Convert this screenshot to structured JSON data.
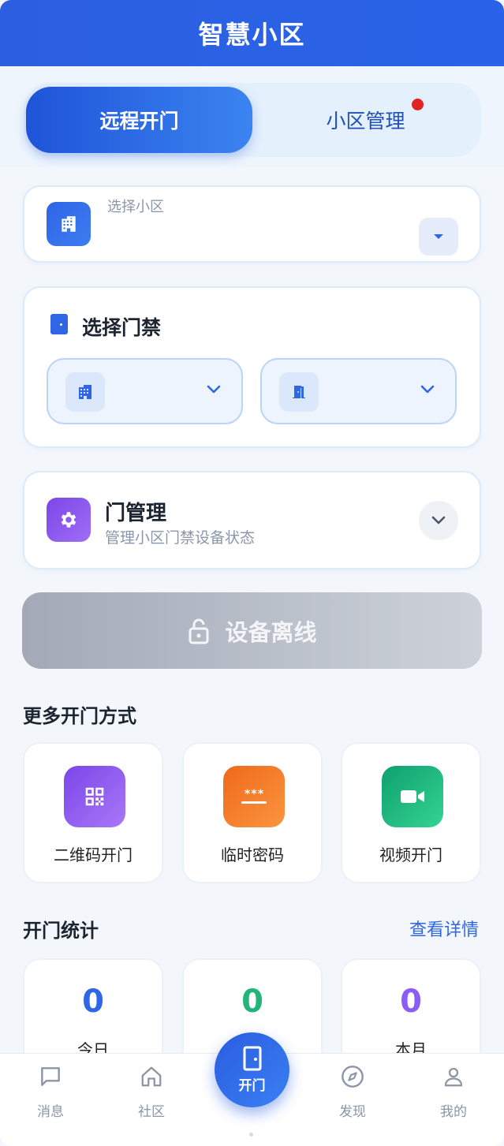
{
  "header": {
    "title": "智慧小区"
  },
  "tabs": [
    {
      "label": "远程开门",
      "active": true
    },
    {
      "label": "小区管理",
      "active": false,
      "has_badge": true
    }
  ],
  "community_select": {
    "label": "选择小区",
    "value": ""
  },
  "door_select": {
    "title": "选择门禁",
    "building_icon": "building-icon",
    "door_icon": "door-icon"
  },
  "door_management": {
    "title": "门管理",
    "subtitle": "管理小区门禁设备状态"
  },
  "unlock_button": {
    "label": "设备离线",
    "icon": "lock-icon",
    "disabled": true
  },
  "more_methods": {
    "title": "更多开门方式",
    "items": [
      {
        "label": "二维码开门",
        "icon": "qrcode-icon",
        "color": "#8b5cf6"
      },
      {
        "label": "临时密码",
        "icon": "password-icon",
        "color": "#f97316"
      },
      {
        "label": "视频开门",
        "icon": "video-icon",
        "color": "#10b981"
      }
    ]
  },
  "stats": {
    "title": "开门统计",
    "link": "查看详情",
    "items": [
      {
        "value": "0",
        "label": "今日",
        "color": "#2e66e6"
      },
      {
        "value": "0",
        "label": "",
        "color": "#22b47a"
      },
      {
        "value": "0",
        "label": "本月",
        "color": "#8b5cf6"
      }
    ]
  },
  "bottom_nav": {
    "items": [
      {
        "label": "消息",
        "icon": "message-icon"
      },
      {
        "label": "社区",
        "icon": "home-icon"
      },
      {
        "label": "开门",
        "icon": "door-icon",
        "center": true
      },
      {
        "label": "发现",
        "icon": "compass-icon"
      },
      {
        "label": "我的",
        "icon": "user-icon"
      }
    ]
  }
}
